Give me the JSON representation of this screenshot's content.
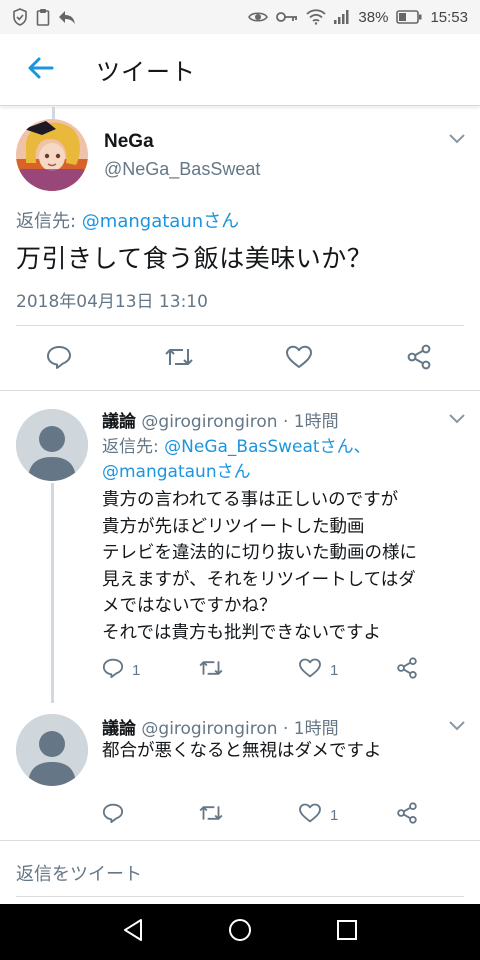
{
  "status_bar": {
    "battery": "38%",
    "time": "15:53",
    "icons": [
      "shield-icon",
      "clipboard-icon",
      "share-arrow-icon",
      "eye-icon",
      "key-icon",
      "wifi-icon",
      "signal-icon",
      "battery-icon"
    ]
  },
  "header": {
    "title": "ツイート",
    "back_icon": "back-arrow-icon"
  },
  "main_tweet": {
    "name": "NeGa",
    "handle": "@NeGa_BasSweat",
    "reply_prefix": "返信先: ",
    "reply_target": "@mangataunさん",
    "text": "万引きして食う飯は美味いか？",
    "datetime": "2018年04月13日 13:10"
  },
  "replies": [
    {
      "name": "議論",
      "handle": "@girogirongiron",
      "time": "· 1時間",
      "reply_prefix": "返信先: ",
      "reply_target_1": "@NeGa_BasSweatさん、",
      "reply_target_2": "@mangataunさん",
      "text": "貴方の言われてる事は正しいのですが\n貴方が先ほどリツイートした動画\nテレビを違法的に切り抜いた動画の様に\n見えますが、それをリツイートしてはダ\nメではないですかね？\nそれでは貴方も批判できないですよ",
      "reply_count": "1",
      "like_count": "1"
    },
    {
      "name": "議論",
      "handle": "@girogirongiron",
      "time": "· 1時間",
      "text": "都合が悪くなると無視はダメですよ",
      "like_count": "1"
    }
  ],
  "compose": {
    "placeholder": "返信をツイート"
  },
  "colors": {
    "accent": "#1b95e0",
    "secondary_text": "#657786",
    "icon": "#657786"
  }
}
